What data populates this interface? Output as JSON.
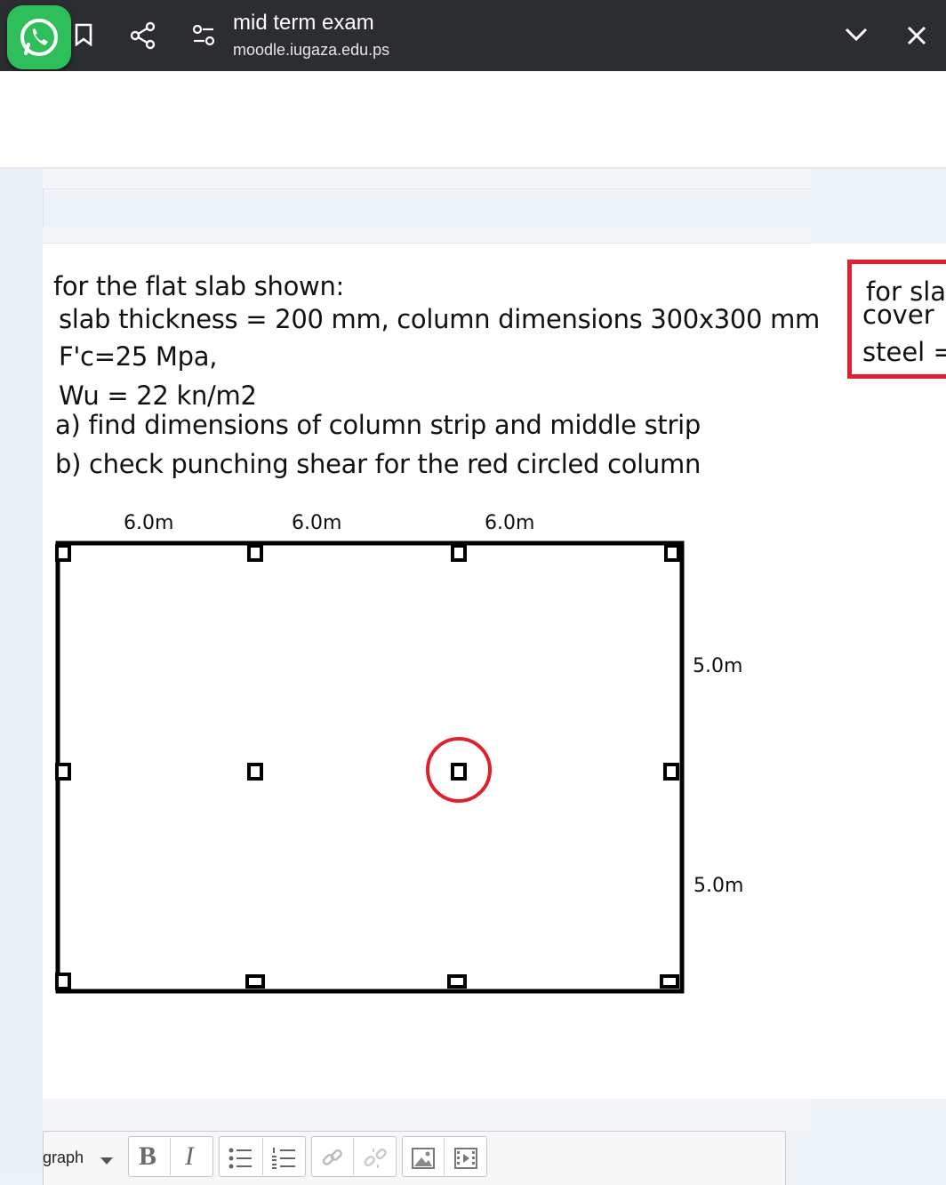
{
  "browser": {
    "title": "mid term exam",
    "url": "moodle.iugaza.edu.ps"
  },
  "question": {
    "lines": [
      "for the flat slab shown:",
      "slab thickness = 200 mm, column dimensions 300x300  mm",
      "F'c=25 Mpa,",
      "Wu = 22 kn/m2",
      "a)  find dimensions of column strip and middle strip",
      "b)  check punching shear for the red circled column"
    ],
    "side_box": [
      "for sla",
      "cover",
      "steel ="
    ]
  },
  "diagram": {
    "span_labels": [
      "6.0m",
      "6.0m",
      "6.0m"
    ],
    "bay_labels": [
      "5.0m",
      "5.0m"
    ],
    "circle_color": "#e0202c"
  },
  "editor": {
    "paragraph_label": "graph",
    "bold": "B",
    "italic": "I"
  }
}
